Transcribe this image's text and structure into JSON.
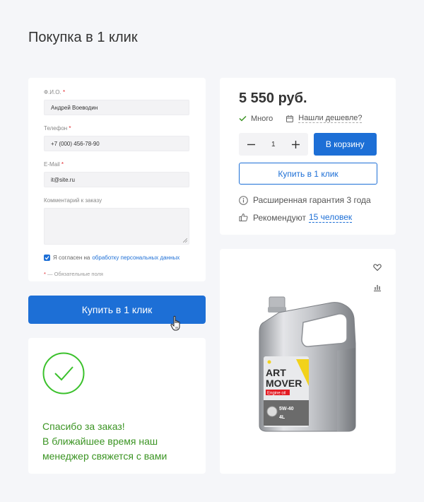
{
  "page": {
    "title": "Покупка в 1 клик"
  },
  "form": {
    "name_label": "Ф.И.О.",
    "name_value": "Андрей Воеводин",
    "phone_label": "Телефон",
    "phone_value": "+7 (000) 456-78-90",
    "email_label": "E-Mail",
    "email_value": "it@site.ru",
    "comment_label": "Комментарий к заказу",
    "comment_value": "",
    "required_mark": "*",
    "consent_text": "Я согласен на",
    "consent_link": "обработку персональных данных",
    "consent_checked": true,
    "required_note": "— Обязательные поля"
  },
  "buy_button": {
    "label": "Купить в 1 клик"
  },
  "success": {
    "line1": "Спасибо за заказ!",
    "line2": "В ближайшее время наш",
    "line3": "менеджер свяжется с вами"
  },
  "product": {
    "price": "5 550 руб.",
    "stock": "Много",
    "cheaper": "Нашли дешевле?",
    "quantity": "1",
    "cart_label": "В корзину",
    "oneclick_label": "Купить в 1 клик",
    "warranty": "Расширенная гарантия 3 года",
    "recommend_text": "Рекомендуют",
    "recommend_link": "15 человек",
    "label_line1": "ART",
    "label_line2": "MOVER",
    "label_sub": "Engine oil",
    "label_spec": "5W-40",
    "label_volume": "4L"
  },
  "colors": {
    "accent": "#1d6fd6",
    "success": "#3b9423",
    "required": "#e0262b"
  },
  "icons": [
    "checkmark-icon",
    "price-tag-icon",
    "minus-icon",
    "plus-icon",
    "info-icon",
    "thumbs-up-icon",
    "heart-icon",
    "stats-icon",
    "cursor-hand-icon",
    "check-circle-icon"
  ]
}
